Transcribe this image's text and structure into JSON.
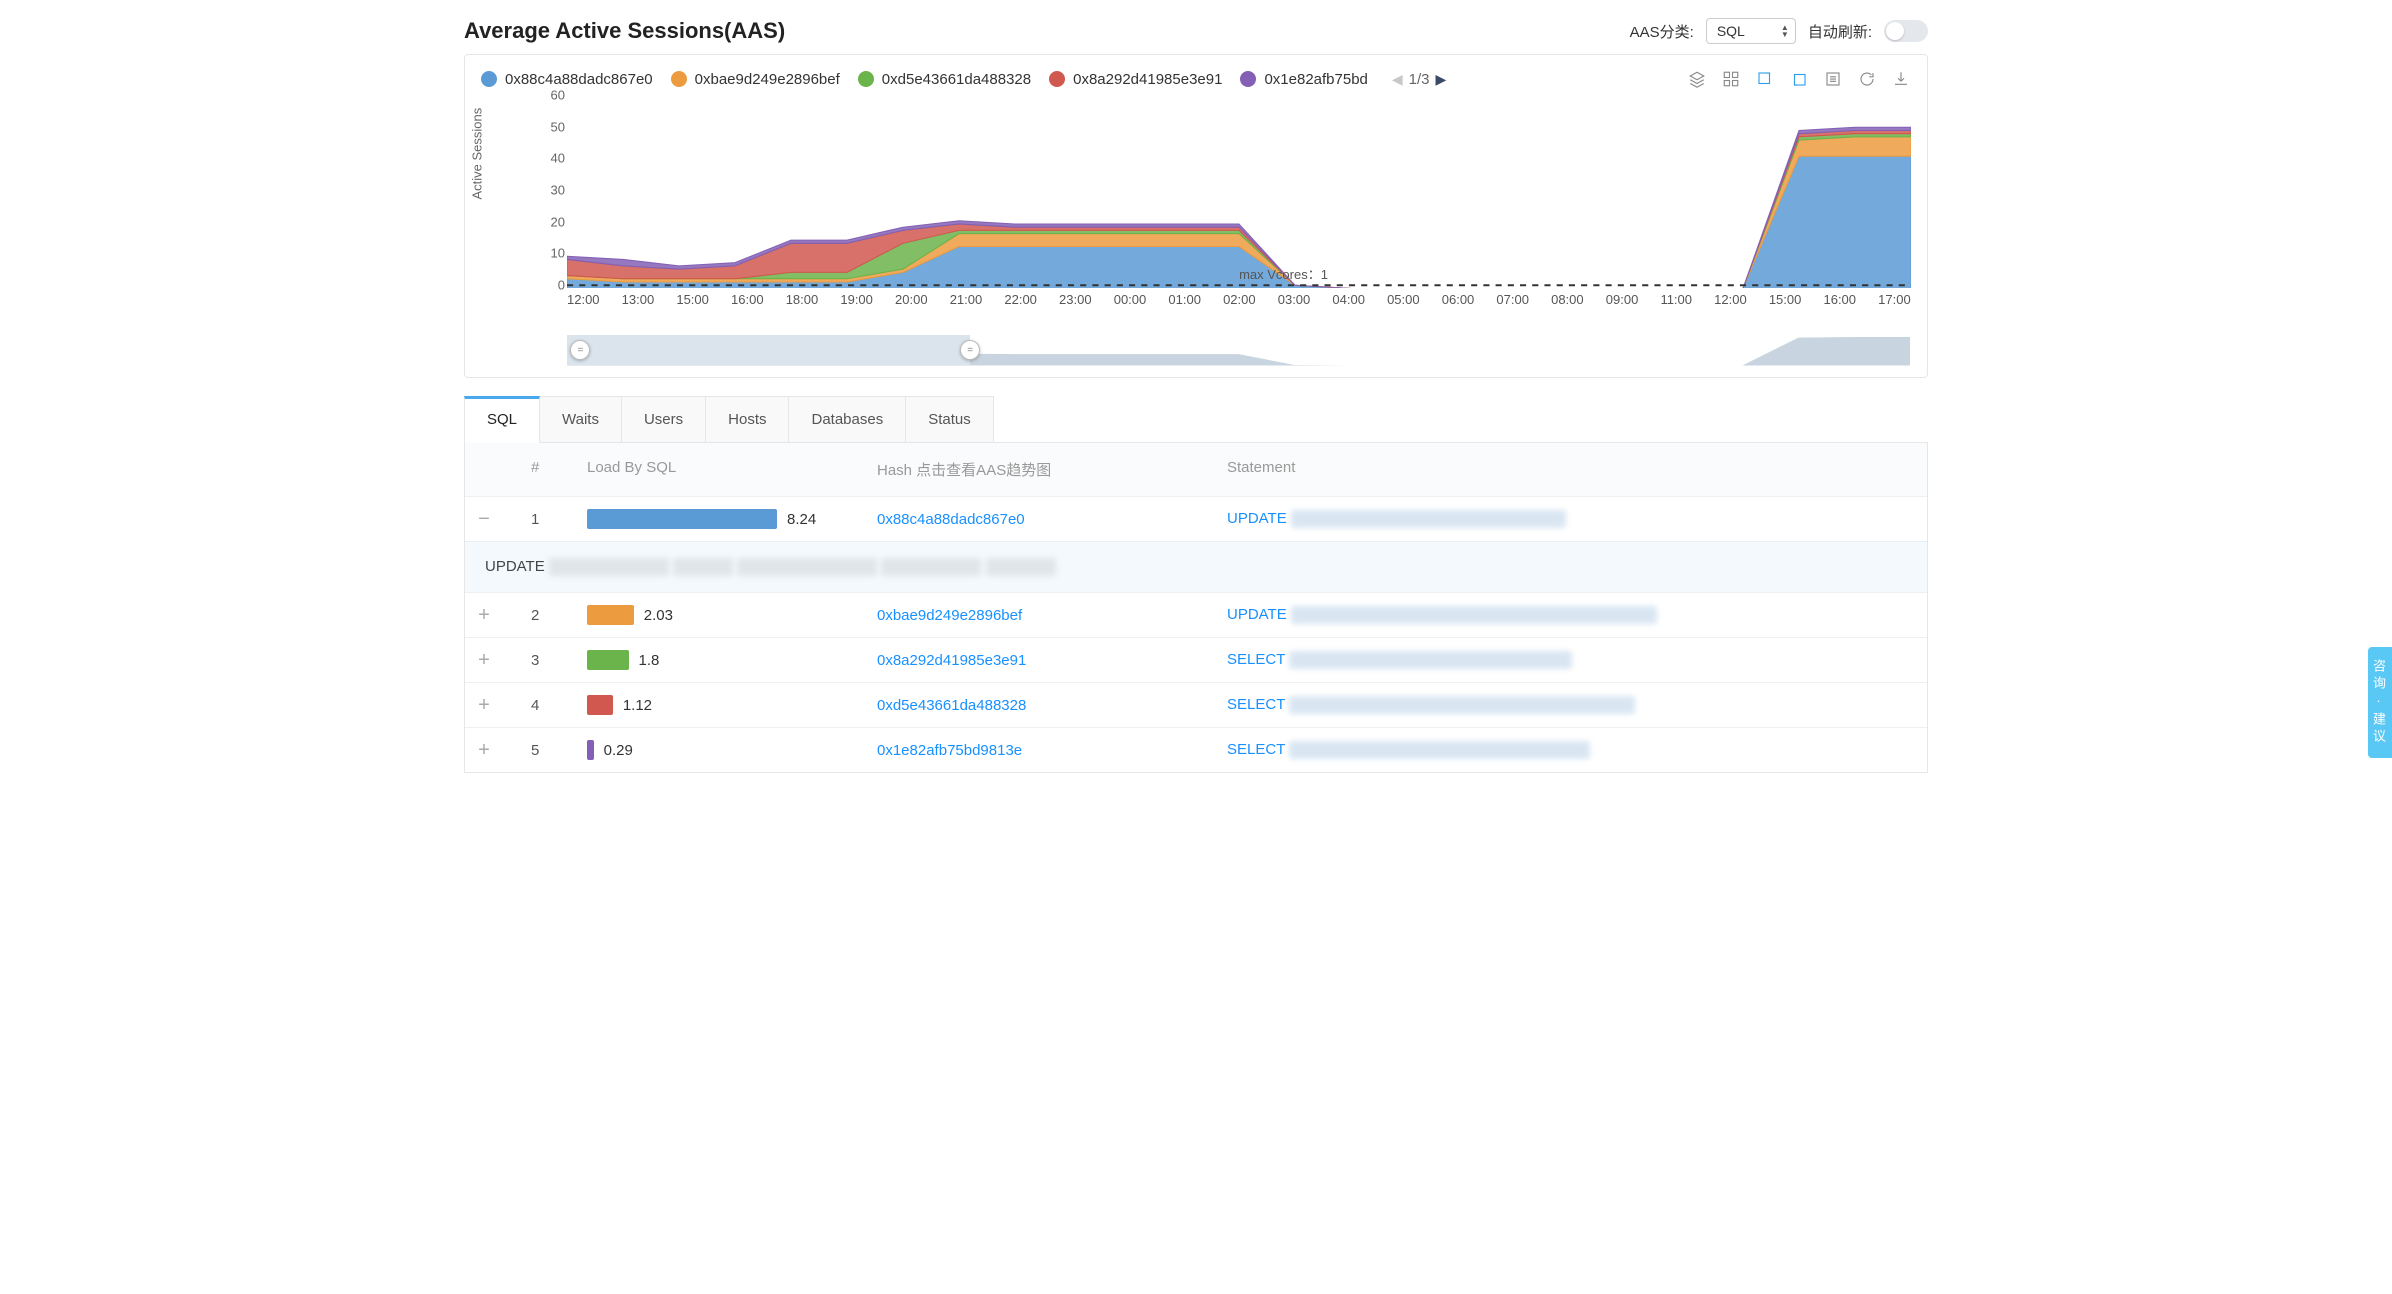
{
  "header": {
    "title": "Average Active Sessions(AAS)",
    "category_label": "AAS分类:",
    "category_value": "SQL",
    "auto_refresh_label": "自动刷新:",
    "auto_refresh_on": false
  },
  "legend": {
    "items": [
      {
        "label": "0x88c4a88dadc867e0",
        "color": "#5b9bd5"
      },
      {
        "label": "0xbae9d249e2896bef",
        "color": "#ed9b3f"
      },
      {
        "label": "0xd5e43661da488328",
        "color": "#6bb34b"
      },
      {
        "label": "0x8a292d41985e3e91",
        "color": "#d1584f"
      },
      {
        "label": "0x1e82afb75bd",
        "color": "#8360b5"
      }
    ],
    "pager": "1/3"
  },
  "chart_data": {
    "type": "area",
    "title": "",
    "xlabel": "",
    "ylabel": "Active Sessions",
    "ylim": [
      0,
      60
    ],
    "yticks": [
      0,
      10,
      20,
      30,
      40,
      50,
      60
    ],
    "categories": [
      "12:00",
      "13:00",
      "15:00",
      "16:00",
      "18:00",
      "19:00",
      "20:00",
      "21:00",
      "22:00",
      "23:00",
      "00:00",
      "01:00",
      "02:00",
      "03:00",
      "04:00",
      "05:00",
      "06:00",
      "07:00",
      "08:00",
      "09:00",
      "11:00",
      "12:00",
      "15:00",
      "16:00",
      "17:00"
    ],
    "annotation": {
      "text": "max Vcores：1",
      "y": 1
    },
    "series": [
      {
        "name": "0x88c4a88dadc867e0",
        "color": "#5b9bd5",
        "values": [
          3,
          2,
          2,
          2,
          2,
          2,
          5,
          13,
          13,
          13,
          13,
          13,
          13,
          1,
          0,
          0,
          0,
          0,
          0,
          0,
          0,
          0,
          41,
          41,
          41
        ]
      },
      {
        "name": "0xbae9d249e2896bef",
        "color": "#ed9b3f",
        "values": [
          1,
          1,
          1,
          1,
          1,
          1,
          1,
          4,
          4,
          4,
          4,
          4,
          4,
          0,
          0,
          0,
          0,
          0,
          0,
          0,
          0,
          0,
          5,
          6,
          6
        ]
      },
      {
        "name": "0xd5e43661da488328",
        "color": "#6bb34b",
        "values": [
          0,
          0,
          0,
          0,
          2,
          2,
          8,
          1,
          1,
          1,
          1,
          1,
          1,
          0,
          0,
          0,
          0,
          0,
          0,
          0,
          0,
          0,
          1,
          1,
          1
        ]
      },
      {
        "name": "0x8a292d41985e3e91",
        "color": "#d1584f",
        "values": [
          5,
          4,
          3,
          4,
          9,
          9,
          4,
          2,
          1,
          1,
          1,
          1,
          1,
          0,
          0,
          0,
          0,
          0,
          0,
          0,
          0,
          0,
          1,
          1,
          1
        ]
      },
      {
        "name": "0x1e82afb75bd",
        "color": "#8360b5",
        "values": [
          1,
          2,
          1,
          1,
          1,
          1,
          1,
          1,
          1,
          1,
          1,
          1,
          1,
          0,
          0,
          0,
          0,
          0,
          0,
          0,
          0,
          0,
          1,
          1,
          1
        ]
      }
    ]
  },
  "tabs": [
    {
      "id": "sql",
      "label": "SQL",
      "active": true
    },
    {
      "id": "waits",
      "label": "Waits",
      "active": false
    },
    {
      "id": "users",
      "label": "Users",
      "active": false
    },
    {
      "id": "hosts",
      "label": "Hosts",
      "active": false
    },
    {
      "id": "databases",
      "label": "Databases",
      "active": false
    },
    {
      "id": "status",
      "label": "Status",
      "active": false
    }
  ],
  "table": {
    "columns": {
      "rank": "#",
      "load": "Load By SQL",
      "hash": "Hash 点击查看AAS趋势图",
      "stmt": "Statement"
    },
    "max_load": 8.24,
    "rows": [
      {
        "rank": 1,
        "load": 8.24,
        "color": "#5b9bd5",
        "hash": "0x88c4a88dadc867e0",
        "stmt": "UPDATE",
        "expanded": true,
        "detail_prefix": "UPDATE"
      },
      {
        "rank": 2,
        "load": 2.03,
        "color": "#ed9b3f",
        "hash": "0xbae9d249e2896bef",
        "stmt": "UPDATE",
        "expanded": false
      },
      {
        "rank": 3,
        "load": 1.8,
        "color": "#6bb34b",
        "hash": "0x8a292d41985e3e91",
        "stmt": "SELECT",
        "expanded": false
      },
      {
        "rank": 4,
        "load": 1.12,
        "color": "#d1584f",
        "hash": "0xd5e43661da488328",
        "stmt": "SELECT",
        "expanded": false
      },
      {
        "rank": 5,
        "load": 0.29,
        "color": "#8360b5",
        "hash": "0x1e82afb75bd9813e",
        "stmt": "SELECT",
        "expanded": false
      }
    ]
  },
  "side_tab": "咨询·建议"
}
